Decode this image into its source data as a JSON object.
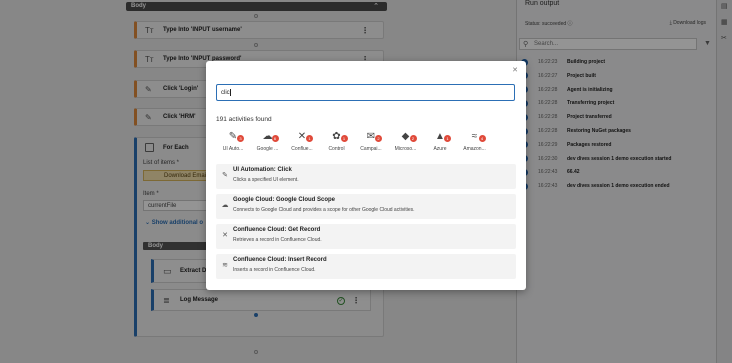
{
  "canvas": {
    "body_label": "Body",
    "activities": [
      {
        "label": "Type Into 'INPUT username'"
      },
      {
        "label": "Type Into 'INPUT password'"
      },
      {
        "label": "Click 'Login'"
      },
      {
        "label": "Click 'HRM'"
      }
    ],
    "foreach": {
      "title": "For Each",
      "list_label": "List of items *",
      "list_value": "Download Email",
      "item_label": "Item *",
      "item_value": "currentFile",
      "show_more": "Show additional o",
      "inner_body": "Body",
      "inner_activities": [
        {
          "label": "Extract D"
        },
        {
          "label": "Log Message"
        }
      ]
    }
  },
  "run_output": {
    "title": "Run output",
    "status": "Status: succeeded",
    "download_logs": "Download logs",
    "search_placeholder": "Search...",
    "logs": [
      {
        "time": "16:22:23",
        "message": "Building project"
      },
      {
        "time": "16:22:27",
        "message": "Project built"
      },
      {
        "time": "16:22:28",
        "message": "Agent is initializing"
      },
      {
        "time": "16:22:28",
        "message": "Transferring project"
      },
      {
        "time": "16:22:28",
        "message": "Project transferred"
      },
      {
        "time": "16:22:28",
        "message": "Restoring NuGet packages"
      },
      {
        "time": "16:22:29",
        "message": "Packages restored"
      },
      {
        "time": "16:22:30",
        "message": "dev dives session 1 demo execution started"
      },
      {
        "time": "16:22:43",
        "message": "66.42"
      },
      {
        "time": "16:22:43",
        "message": "dev dives session 1 demo execution ended"
      }
    ]
  },
  "modal": {
    "search_value": "clic",
    "results_count": "191 activities found",
    "categories": [
      {
        "label": "UI Auto...",
        "icon": "✎",
        "badge": "3"
      },
      {
        "label": "Google ...",
        "icon": "☁",
        "badge": "6"
      },
      {
        "label": "Conflue...",
        "icon": "✕",
        "badge": "1"
      },
      {
        "label": "Control",
        "icon": "✿",
        "badge": "1"
      },
      {
        "label": "Campai...",
        "icon": "✉",
        "badge": "2"
      },
      {
        "label": "Microso...",
        "icon": "◆",
        "badge": "2"
      },
      {
        "label": "Azure",
        "icon": "▲",
        "badge": "1"
      },
      {
        "label": "Amazon...",
        "icon": "≈",
        "badge": "4"
      }
    ],
    "results": [
      {
        "title": "UI Automation: Click",
        "desc": "Clicks a specified UI element.",
        "icon": "✎"
      },
      {
        "title": "Google Cloud: Google Cloud Scope",
        "desc": "Connects to Google Cloud and provides a scope for other Google Cloud activities.",
        "icon": "☁"
      },
      {
        "title": "Confluence Cloud: Get Record",
        "desc": "Retrieves a record in Confluence Cloud.",
        "icon": "✕"
      },
      {
        "title": "Confluence Cloud: Insert Record",
        "desc": "Inserts a record in Confluence Cloud.",
        "icon": "≋"
      }
    ],
    "accent": "#2c6fb5"
  }
}
